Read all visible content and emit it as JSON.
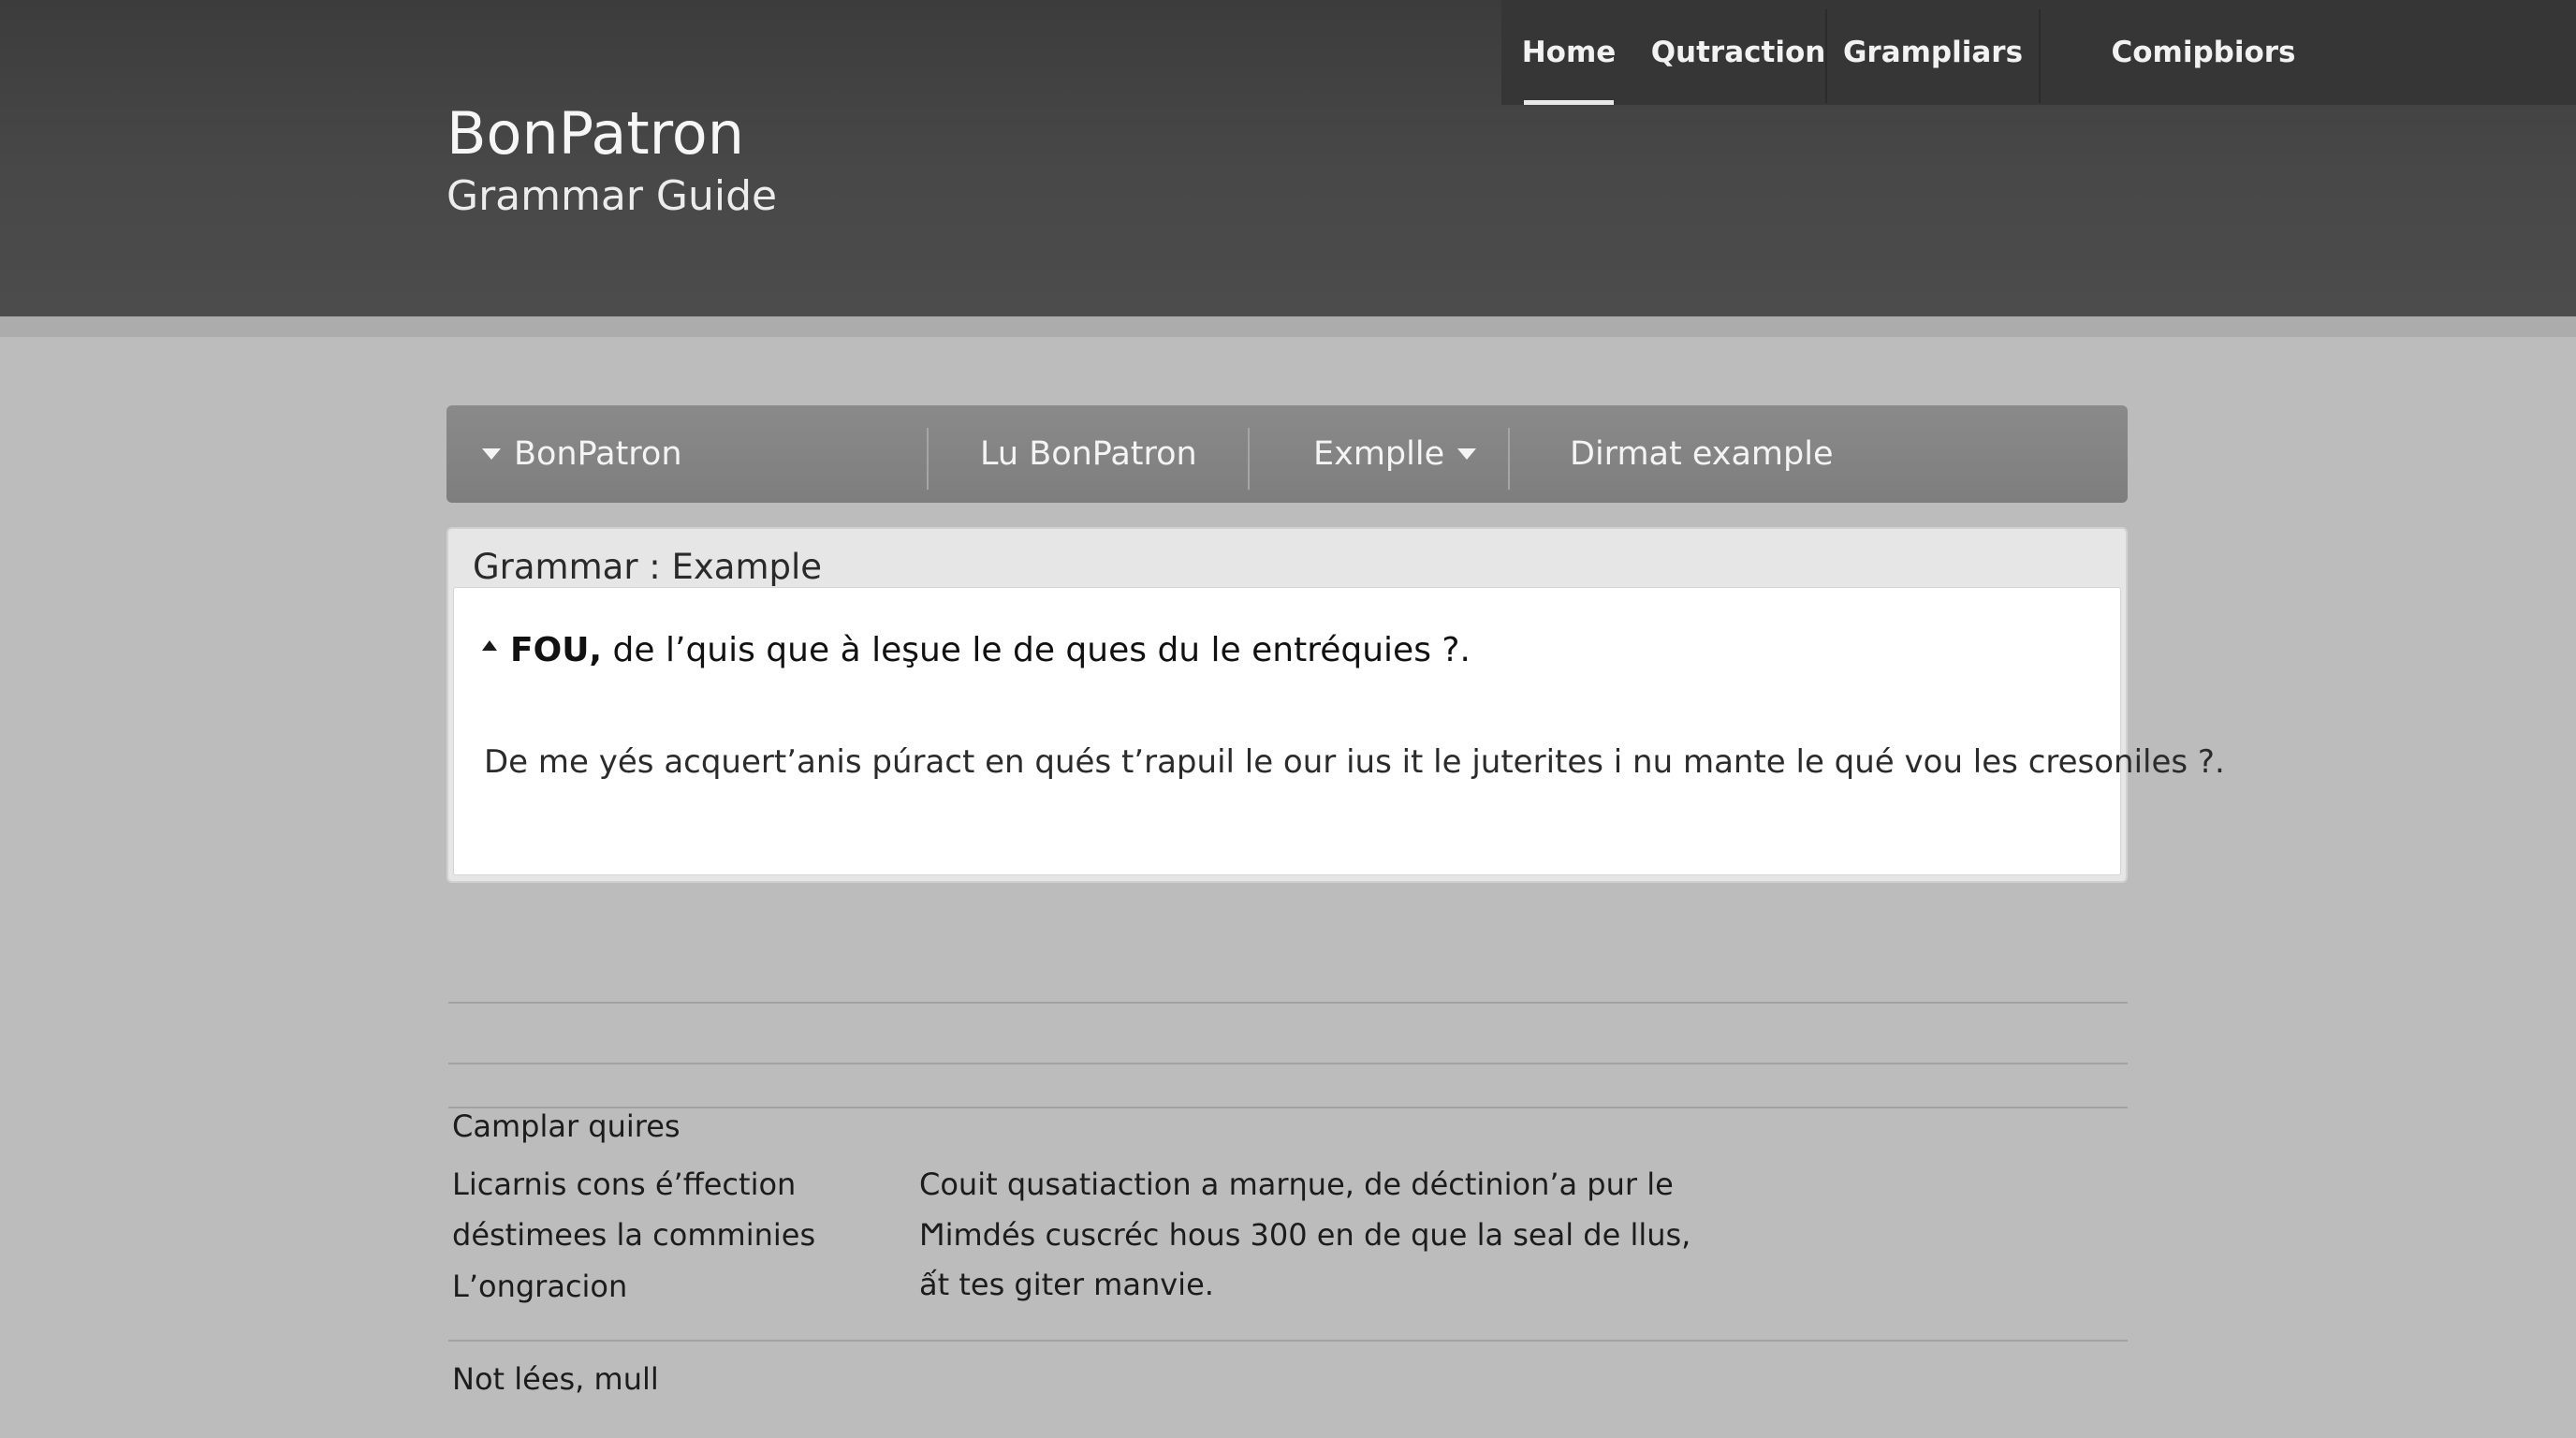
{
  "header": {
    "title": "BonPatron",
    "subtitle": "Grammar Guide"
  },
  "top_nav": {
    "items": [
      {
        "label": "Home",
        "active": true
      },
      {
        "label": "Qutraction",
        "active": false
      },
      {
        "label": "Grampliars",
        "active": false
      },
      {
        "label": "Comipbiors",
        "active": false
      }
    ]
  },
  "sub_nav": {
    "items": [
      {
        "label": "BonPatron",
        "dropdown": "leading"
      },
      {
        "label": "Lu BonPatron",
        "dropdown": "none"
      },
      {
        "label": "Exmplle",
        "dropdown": "trailing"
      },
      {
        "label": "Dirmat example",
        "dropdown": "none"
      }
    ]
  },
  "panel": {
    "title": "Grammar : Example",
    "question_strong": "FOU,",
    "question_rest": " de l’quis que à leşue le de ques du le entréquies ?.",
    "answer": "De me yés acquert’anis púract en qués t’rapuil le our ius it le juterites i nu mante le qué vou les cresoniles ?."
  },
  "section": {
    "heading": "Camplar quires",
    "left_lines": [
      "Licarnis cons é’ffection",
      "déstimees la comminies",
      "L’ongracion"
    ],
    "right_lines": [
      "Couit qusatiaction a marηue, de déctinion’a pur le",
      "Ϻimdés cuscréc hous 300 en de que la seal de llus,",
      "ất tes giter manvie."
    ],
    "footer": "Not lées, mull"
  },
  "colors": {
    "header_bg": "#444444",
    "page_bg": "#bcbcbc",
    "subnav_bg": "#848484",
    "panel_body_bg": "#ffffff"
  }
}
